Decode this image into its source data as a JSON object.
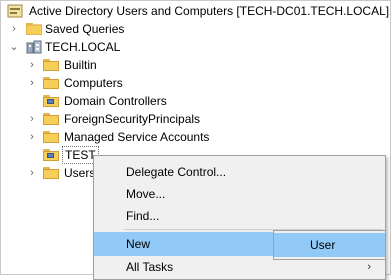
{
  "window_title": "Active Directory Users and Computers [TECH-DC01.TECH.LOCAL]",
  "tree": {
    "saved_queries": "Saved Queries",
    "domain": "TECH.LOCAL",
    "items": [
      {
        "label": "Builtin",
        "icon": "folder-icon"
      },
      {
        "label": "Computers",
        "icon": "folder-icon"
      },
      {
        "label": "Domain Controllers",
        "icon": "ou-icon"
      },
      {
        "label": "ForeignSecurityPrincipals",
        "icon": "folder-icon"
      },
      {
        "label": "Managed Service Accounts",
        "icon": "folder-icon"
      },
      {
        "label": "TEST",
        "icon": "ou-icon"
      },
      {
        "label": "Users",
        "icon": "folder-icon"
      }
    ]
  },
  "context_menu": {
    "items": [
      "Delegate Control...",
      "Move...",
      "Find...",
      "New",
      "All Tasks"
    ],
    "submenu_arrow": "›"
  },
  "submenu": {
    "items": [
      "User"
    ]
  },
  "colors": {
    "highlight": "#91c9f7",
    "folder": "#f6cf5a",
    "menu_bg": "#f0f0f0"
  }
}
